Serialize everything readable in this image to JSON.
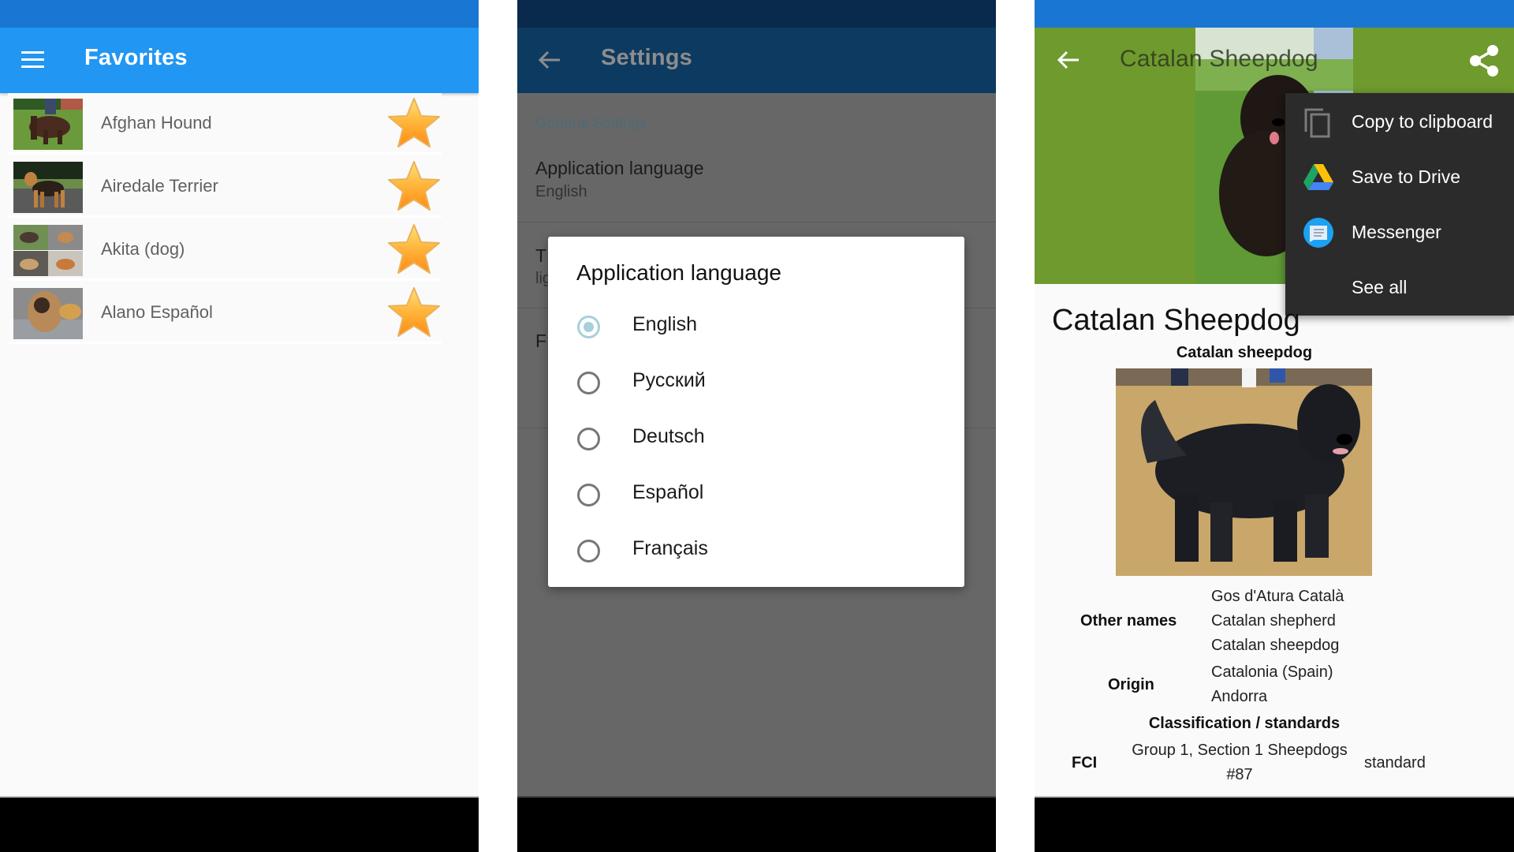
{
  "panels": {
    "favorites": {
      "title": "Favorites",
      "menu_icon": "hamburger-menu-icon",
      "items": [
        {
          "name": "Afghan Hound",
          "favorite": true,
          "thumb": "afghan-hound-photo"
        },
        {
          "name": "Airedale Terrier",
          "favorite": true,
          "thumb": "airedale-terrier-photo"
        },
        {
          "name": "Akita (dog)",
          "favorite": true,
          "thumb": "akita-collage-photo"
        },
        {
          "name": "Alano Español",
          "favorite": true,
          "thumb": "alano-espanol-photo"
        }
      ],
      "colors": {
        "status_bar": "#1976D2",
        "toolbar": "#2196F3",
        "star": "#FFA726"
      }
    },
    "settings": {
      "title": "Settings",
      "back_icon": "back-arrow-icon",
      "section_header": "General Settings",
      "items": [
        {
          "title": "Application language",
          "subtitle": "English"
        },
        {
          "title": "T",
          "subtitle": "lig"
        },
        {
          "title": "F",
          "subtitle": ""
        }
      ],
      "dialog": {
        "title": "Application language",
        "selected": "English",
        "options": [
          "English",
          "Русский",
          "Deutsch",
          "Español",
          "Français"
        ]
      },
      "colors": {
        "radio_checked": "#A7D0DC",
        "scrim": "#676767"
      }
    },
    "breed": {
      "toolbar_title": "Catalan Sheepdog",
      "back_icon": "back-arrow-icon",
      "share_icon": "share-icon",
      "share_menu": [
        {
          "label": "Copy to clipboard",
          "icon": "copy-icon"
        },
        {
          "label": "Save to Drive",
          "icon": "google-drive-icon"
        },
        {
          "label": "Messenger",
          "icon": "messenger-icon"
        },
        {
          "label": "See all",
          "icon": ""
        }
      ],
      "heading": "Catalan Sheepdog",
      "infobox": {
        "caption": "Catalan sheepdog",
        "other_names_label": "Other names",
        "other_names": [
          "Gos d'Atura Català",
          "Catalan shepherd",
          "Catalan sheepdog"
        ],
        "origin_label": "Origin",
        "origin": [
          "Catalonia (Spain)",
          "Andorra"
        ],
        "classification_header": "Classification / standards",
        "fci_label": "FCI",
        "fci_group": "Group 1, Section 1 Sheepdogs",
        "fci_number": "#87",
        "fci_standard": "standard"
      },
      "colors": {
        "header": "#6F9A2E",
        "menu_bg": "#2B2B2B"
      }
    }
  }
}
